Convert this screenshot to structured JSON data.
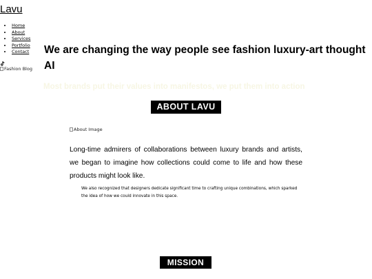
{
  "site": {
    "logo": "Lavu"
  },
  "nav": {
    "items": [
      "Home",
      "About",
      "Services",
      "Portfolio",
      "Contact"
    ]
  },
  "icons": {
    "social": "tiktok-icon",
    "broken_image": "broken-image-icon"
  },
  "images": {
    "blog_alt": "Fashion Blog",
    "about_alt": "About Image"
  },
  "hero": {
    "title": "We are changing the way people see fashion luxury-art thought AI",
    "subtitle": "Most brands put their values into manifestos, we put them into action"
  },
  "about": {
    "heading": "ABOUT LAVU",
    "paragraph1": "Long-time admirers of collaborations between luxury brands and artists, we began to imagine how collections could come to life and how these products might look like.",
    "paragraph2": "We also recognized that designers dedicate significant time to crafting unique combinations, which sparked the idea of how we could innovate in this space."
  },
  "mission": {
    "heading": "MISSION"
  },
  "colors": {
    "heading_bg": "#000000",
    "heading_text": "#ffffff",
    "subtitle": "#f7f6e4"
  }
}
